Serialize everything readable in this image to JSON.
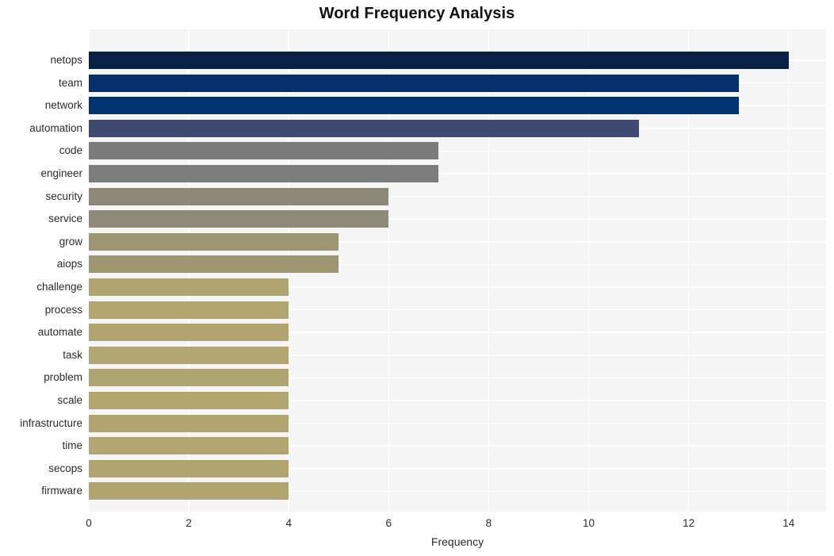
{
  "chart_data": {
    "type": "bar",
    "orientation": "horizontal",
    "title": "Word Frequency Analysis",
    "xlabel": "Frequency",
    "ylabel": "",
    "xlim": [
      0,
      14.75
    ],
    "xticks": [
      0,
      2,
      4,
      6,
      8,
      10,
      12,
      14
    ],
    "grid": true,
    "legend": "none",
    "categories": [
      "netops",
      "team",
      "network",
      "automation",
      "code",
      "engineer",
      "security",
      "service",
      "grow",
      "aiops",
      "challenge",
      "process",
      "automate",
      "task",
      "problem",
      "scale",
      "infrastructure",
      "time",
      "secops",
      "firmware"
    ],
    "values": [
      14,
      13,
      13,
      11,
      7,
      7,
      6,
      6,
      5,
      5,
      4,
      4,
      4,
      4,
      4,
      4,
      4,
      4,
      4,
      4
    ],
    "bar_colors": [
      "#0a2146",
      "#043169",
      "#01346e",
      "#3f4a71",
      "#7b7b7b",
      "#7c7c7c",
      "#8e8878",
      "#8d8a77",
      "#9c9572",
      "#9d9671",
      "#b0a571",
      "#b1a570",
      "#b0a570",
      "#b1a570",
      "#b0a570",
      "#b1a570",
      "#b0a570",
      "#b1a570",
      "#b0a570",
      "#b0a56f"
    ]
  },
  "plot_style": {
    "plot_background": "#f5f5f6",
    "grid_color": "#ffffff",
    "page_background": "#ffffff",
    "text_color": "#2b2b2b",
    "title_color": "#121212"
  }
}
